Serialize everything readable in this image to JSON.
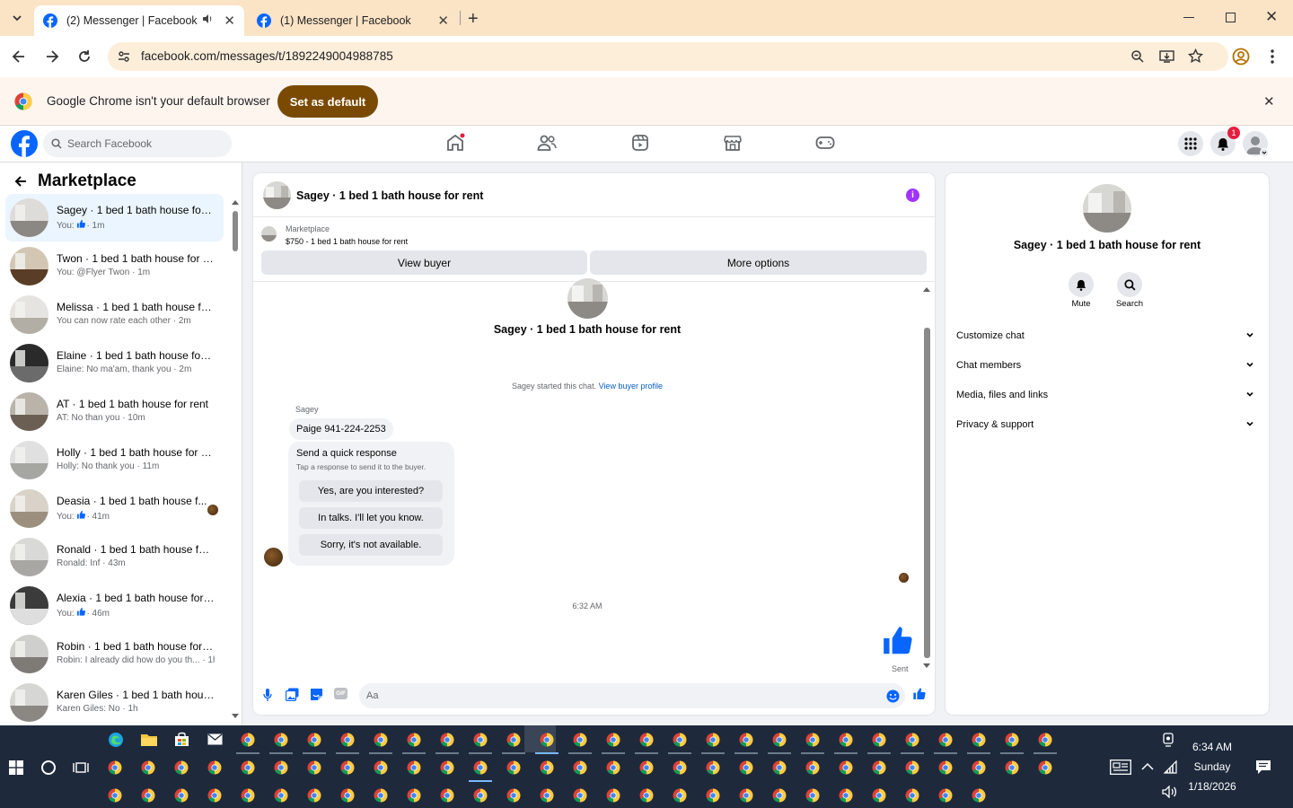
{
  "browser": {
    "tabs": [
      {
        "title": "(2) Messenger | Facebook",
        "active": true,
        "audio": true
      },
      {
        "title": "(1) Messenger | Facebook",
        "active": false
      }
    ],
    "url": "facebook.com/messages/t/1892249004988785",
    "infobar": {
      "message": "Google Chrome isn't your default browser",
      "button": "Set as default"
    }
  },
  "fb": {
    "search_placeholder": "Search Facebook",
    "notification_count": "1"
  },
  "sidebar": {
    "title": "Marketplace",
    "conversations": [
      {
        "name": "Sagey · 1 bed 1 bath house for r...",
        "preview_prefix": "You:",
        "time": "· 1m",
        "like": true,
        "selected": true,
        "preview": ""
      },
      {
        "name": "Twon · 1 bed 1 bath house for r...",
        "preview": "You: @Flyer Twon · 1m"
      },
      {
        "name": "Melissa · 1 bed 1 bath house for...",
        "preview": "You can now rate each other · 2m"
      },
      {
        "name": "Elaine · 1 bed 1 bath house for r...",
        "preview": "Elaine: No ma'am, thank you · 2m"
      },
      {
        "name": "AT · 1 bed 1 bath house for rent",
        "preview": "AT: No than you · 10m"
      },
      {
        "name": "Holly · 1 bed 1 bath house for re...",
        "preview": "Holly: No thank you · 11m"
      },
      {
        "name": "Deasia · 1 bed 1 bath house f...",
        "preview_prefix": "You:",
        "time": "· 41m",
        "like": true,
        "preview": ""
      },
      {
        "name": "Ronald · 1 bed 1 bath house for ...",
        "preview": "Ronald: Inf · 43m"
      },
      {
        "name": "Alexia · 1 bed 1 bath house for r...",
        "preview_prefix": "You:",
        "time": "· 46m",
        "like": true,
        "preview": ""
      },
      {
        "name": "Robin · 1 bed 1 bath house for r...",
        "preview": "Robin: I already did how do you th... · 1h"
      },
      {
        "name": "Karen Giles · 1 bed 1 bath house...",
        "preview": "Karen Giles: No · 1h"
      }
    ]
  },
  "chat": {
    "title": "Sagey · 1 bed 1 bath house for rent",
    "listing_label": "Marketplace",
    "listing_title": "$750 - 1 bed 1 bath house for rent",
    "view_buyer": "View buyer",
    "more_options": "More options",
    "intro_name": "Sagey · 1 bed 1 bath house for rent",
    "started_text": "Sagey started this chat.",
    "view_profile": "View buyer profile",
    "sender": "Sagey",
    "message": "Paige 941-224-2253",
    "quick_title": "Send a quick response",
    "quick_sub": "Tap a response to send it to the buyer.",
    "quick_options": [
      "Yes, are you interested?",
      "In talks. I'll let you know.",
      "Sorry, it's not available."
    ],
    "timestamp": "6:32 AM",
    "sent_label": "Sent",
    "input_placeholder": "Aa"
  },
  "info": {
    "name": "Sagey · 1 bed 1 bath house for rent",
    "mute": "Mute",
    "search": "Search",
    "sections": [
      "Customize chat",
      "Chat members",
      "Media, files and links",
      "Privacy & support"
    ]
  },
  "taskbar": {
    "time": "6:34 AM",
    "day": "Sunday",
    "date": "1/18/2026"
  },
  "colors": {
    "fb_blue": "#0866ff",
    "like_blue": "#0866ff",
    "accent_purple": "#a033ff",
    "infobar_button": "#7a4a03"
  }
}
